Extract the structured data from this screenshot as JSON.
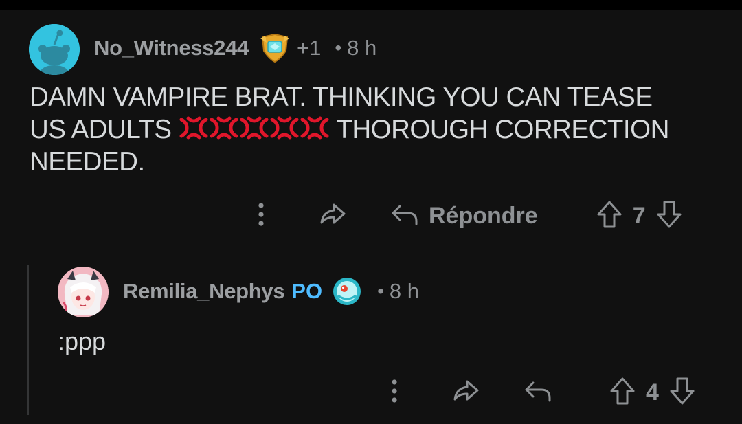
{
  "comments": [
    {
      "username": "No_Witness244",
      "award_icon": "gold-shield-award-icon",
      "karma": "+1",
      "separator": "•",
      "time": "8 h",
      "body_line1": "DAMN VAMPIRE BRAT. THINKING YOU CAN TEASE",
      "body_line2_start": "US ADULTS",
      "body_emoji": [
        "anger-symbol",
        "anger-symbol",
        "anger-symbol",
        "anger-symbol",
        "anger-symbol"
      ],
      "body_line2_end": "THOROUGH CORRECTION",
      "body_line3": "NEEDED.",
      "reply_label": "Répondre",
      "votes": "7"
    },
    {
      "username": "Remilia_Nephys",
      "op_badge": "PO",
      "award_icon": "blue-orb-award-icon",
      "separator": "•",
      "time": "8 h",
      "body": ":ppp",
      "votes": "4"
    }
  ],
  "colors": {
    "background": "#111111",
    "text": "#d7dadc",
    "muted": "#8e9194",
    "op_badge": "#4fbcff",
    "anger_emoji": "#e0162b",
    "avatar1": "#33c3e0"
  }
}
